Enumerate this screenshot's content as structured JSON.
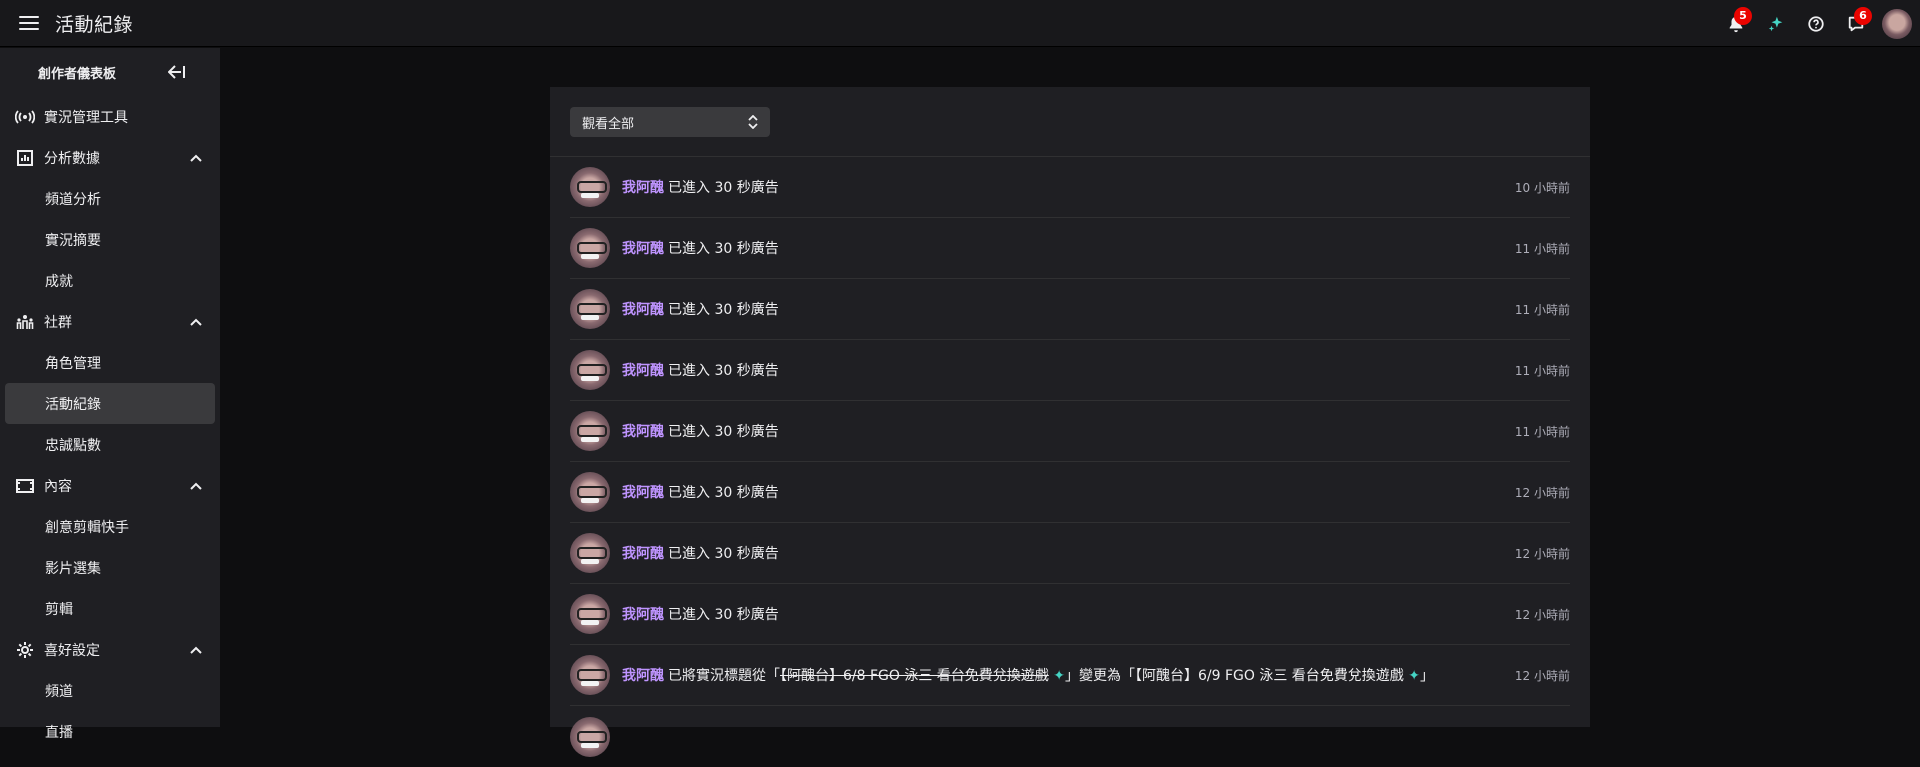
{
  "header": {
    "title": "活動紀錄",
    "notifications_count": "5",
    "whispers_count": "6"
  },
  "sidebar": {
    "title": "創作者儀表板",
    "items": [
      {
        "type": "item",
        "label": "實況管理工具",
        "icon": "broadcast-icon"
      },
      {
        "type": "item",
        "label": "分析數據",
        "icon": "analytics-icon",
        "expanded": true
      },
      {
        "type": "sub",
        "label": "頻道分析"
      },
      {
        "type": "sub",
        "label": "實況摘要"
      },
      {
        "type": "sub",
        "label": "成就"
      },
      {
        "type": "item",
        "label": "社群",
        "icon": "community-icon",
        "expanded": true
      },
      {
        "type": "sub",
        "label": "角色管理"
      },
      {
        "type": "sub",
        "label": "活動紀錄",
        "active": true
      },
      {
        "type": "sub",
        "label": "忠誠點數"
      },
      {
        "type": "item",
        "label": "內容",
        "icon": "content-icon",
        "expanded": true
      },
      {
        "type": "sub",
        "label": "創意剪輯快手"
      },
      {
        "type": "sub",
        "label": "影片選集"
      },
      {
        "type": "sub",
        "label": "剪輯"
      },
      {
        "type": "item",
        "label": "喜好設定",
        "icon": "settings-icon",
        "expanded": true
      },
      {
        "type": "sub",
        "label": "頻道"
      },
      {
        "type": "sub",
        "label": "直播"
      }
    ]
  },
  "filter": {
    "selected": "觀看全部"
  },
  "activity": [
    {
      "user": "我阿醜",
      "action": "已進入 30 秒廣告",
      "time": "10 小時前"
    },
    {
      "user": "我阿醜",
      "action": "已進入 30 秒廣告",
      "time": "11 小時前"
    },
    {
      "user": "我阿醜",
      "action": "已進入 30 秒廣告",
      "time": "11 小時前"
    },
    {
      "user": "我阿醜",
      "action": "已進入 30 秒廣告",
      "time": "11 小時前"
    },
    {
      "user": "我阿醜",
      "action": "已進入 30 秒廣告",
      "time": "11 小時前"
    },
    {
      "user": "我阿醜",
      "action": "已進入 30 秒廣告",
      "time": "12 小時前"
    },
    {
      "user": "我阿醜",
      "action": "已進入 30 秒廣告",
      "time": "12 小時前"
    },
    {
      "user": "我阿醜",
      "action": "已進入 30 秒廣告",
      "time": "12 小時前"
    }
  ],
  "title_change": {
    "user": "我阿醜",
    "prefix": "已將實況標題從「",
    "old_title": "【阿醜台】6/8 FGO 泳三 看台免費兌換遊戲",
    "middle": "」變更為「",
    "new_title": "【阿醜台】6/9 FGO 泳三 看台免費兌換遊戲",
    "suffix": "」",
    "time": "12 小時前"
  },
  "colors": {
    "accent_purple": "#bf94ff",
    "badge_red": "#eb0400",
    "sparkle_teal": "#45d4c4"
  }
}
